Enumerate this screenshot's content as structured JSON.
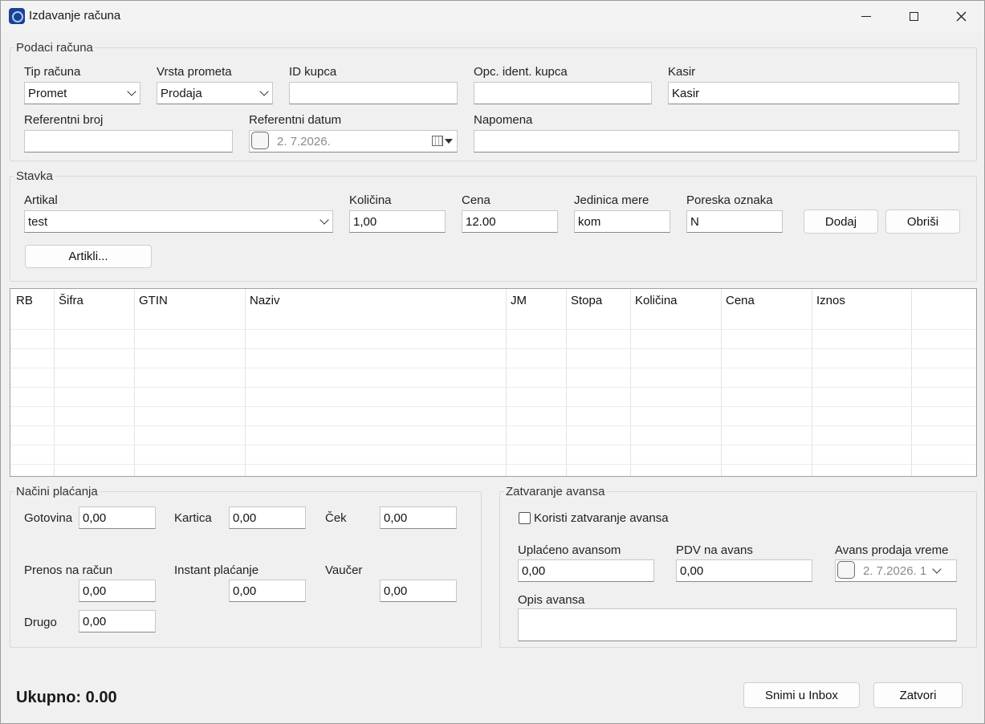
{
  "window": {
    "title": "Izdavanje računa"
  },
  "podaci": {
    "group_label": "Podaci računa",
    "tip_racuna": {
      "label": "Tip računa",
      "value": "Promet"
    },
    "vrsta_prometa": {
      "label": "Vrsta prometa",
      "value": "Prodaja"
    },
    "id_kupca": {
      "label": "ID kupca",
      "value": ""
    },
    "opc_ident": {
      "label": "Opc. ident. kupca",
      "value": ""
    },
    "kasir": {
      "label": "Kasir",
      "value": "Kasir"
    },
    "referentni_broj": {
      "label": "Referentni broj",
      "value": ""
    },
    "referentni_datum": {
      "label": "Referentni datum",
      "value": "2.  7.2026."
    },
    "napomena": {
      "label": "Napomena",
      "value": ""
    }
  },
  "stavka": {
    "group_label": "Stavka",
    "artikal": {
      "label": "Artikal",
      "value": "test"
    },
    "kolicina": {
      "label": "Količina",
      "value": "1,00"
    },
    "cena": {
      "label": "Cena",
      "value": "12.00"
    },
    "jedinica": {
      "label": "Jedinica mere",
      "value": "kom"
    },
    "poreska": {
      "label": "Poreska oznaka",
      "value": "N"
    },
    "dodaj_label": "Dodaj",
    "obrisi_label": "Obriši",
    "artikli_label": "Artikli..."
  },
  "table": {
    "columns": [
      "RB",
      "Šifra",
      "GTIN",
      "Naziv",
      "JM",
      "Stopa",
      "Količina",
      "Cena",
      "Iznos"
    ],
    "rows": []
  },
  "placanje": {
    "group_label": "Načini plaćanja",
    "gotovina": {
      "label": "Gotovina",
      "value": "0,00"
    },
    "kartica": {
      "label": "Kartica",
      "value": "0,00"
    },
    "cek": {
      "label": "Ček",
      "value": "0,00"
    },
    "prenos": {
      "label": "Prenos na račun",
      "value": "0,00"
    },
    "instant": {
      "label": "Instant plaćanje",
      "value": "0,00"
    },
    "vaucer": {
      "label": "Vaučer",
      "value": "0,00"
    },
    "drugo": {
      "label": "Drugo",
      "value": "0,00"
    }
  },
  "avans": {
    "group_label": "Zatvaranje avansa",
    "koristi_label": "Koristi zatvaranje avansa",
    "koristi_checked": false,
    "uplaceno": {
      "label": "Uplaćeno avansom",
      "value": "0,00"
    },
    "pdv": {
      "label": "PDV na avans",
      "value": "0,00"
    },
    "vreme": {
      "label": "Avans prodaja vreme",
      "value": "2.  7.2026. 1"
    },
    "opis": {
      "label": "Opis avansa",
      "value": ""
    }
  },
  "footer": {
    "total_label": "Ukupno: 0.00",
    "snimi_label": "Snimi u Inbox",
    "zatvori_label": "Zatvori"
  },
  "icons": [
    "app-icon",
    "minimize-icon",
    "maximize-icon",
    "close-icon",
    "calendar-icon",
    "chevron-down-icon"
  ]
}
